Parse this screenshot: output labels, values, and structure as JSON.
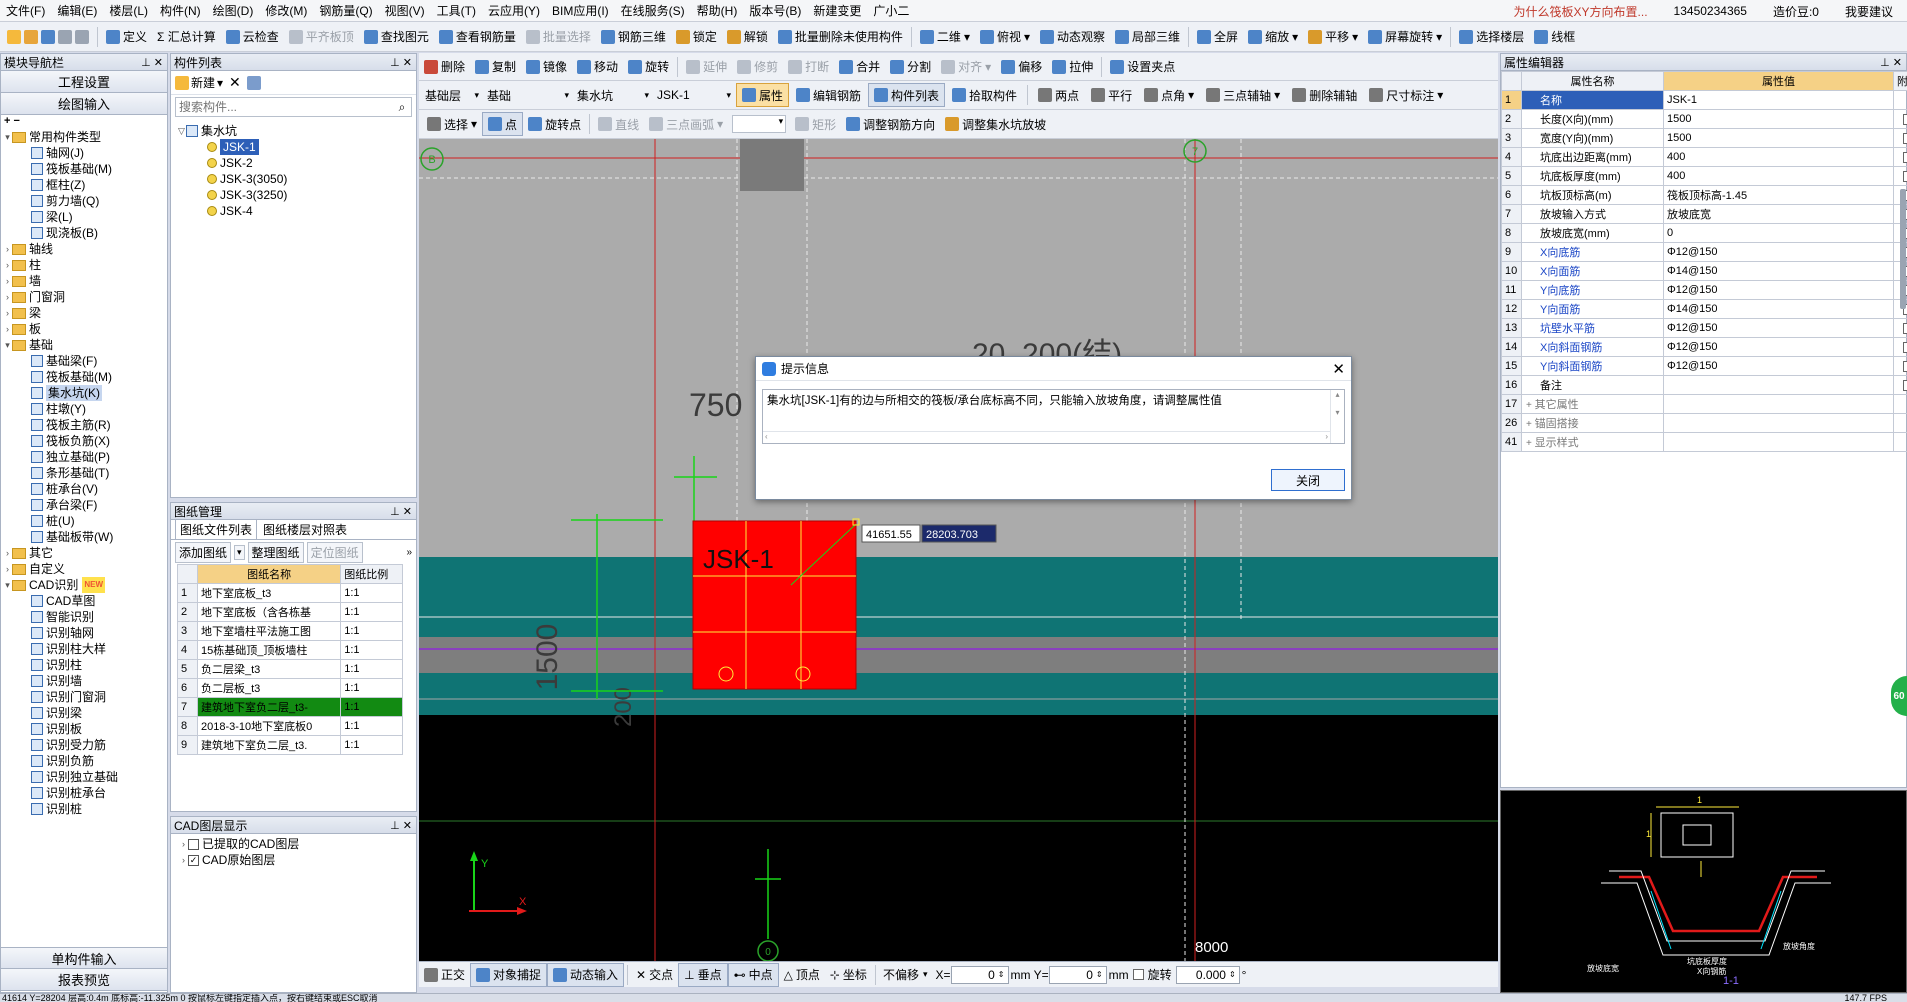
{
  "menubar": {
    "items": [
      "文件(F)",
      "编辑(E)",
      "楼层(L)",
      "构件(N)",
      "绘图(D)",
      "修改(M)",
      "钢筋量(Q)",
      "视图(V)",
      "工具(T)",
      "云应用(Y)",
      "BIM应用(I)",
      "在线服务(S)",
      "帮助(H)",
      "版本号(B)",
      "新建变更",
      "广小二"
    ],
    "ad_text": "为什么筏板XY方向布置...",
    "phone": "13450234365",
    "coin": "造价豆:0",
    "suggest": "我要建议"
  },
  "toolbar1": {
    "items": [
      "定义",
      "Σ 汇总计算",
      "云检查",
      "平齐板顶",
      "查找图元",
      "查看钢筋量",
      "批量选择",
      "钢筋三维",
      "锁定",
      "解锁",
      "批量删除未使用构件",
      "二维",
      "俯视",
      "动态观察",
      "局部三维",
      "全屏",
      "缩放",
      "平移",
      "屏幕旋转",
      "选择楼层",
      "线框"
    ]
  },
  "toolbar2": {
    "items": [
      "删除",
      "复制",
      "镜像",
      "移动",
      "旋转",
      "延伸",
      "修剪",
      "打断",
      "合并",
      "分割",
      "对齐",
      "偏移",
      "拉伸",
      "设置夹点"
    ]
  },
  "toolbar3": {
    "floor": "基础层",
    "category": "基础",
    "type": "集水坑",
    "component": "JSK-1",
    "items": [
      "属性",
      "编辑钢筋",
      "构件列表",
      "拾取构件",
      "两点",
      "平行",
      "点角",
      "三点辅轴",
      "删除辅轴",
      "尺寸标注"
    ]
  },
  "toolbar4": {
    "items": [
      "选择",
      "点",
      "旋转点",
      "直线",
      "三点画弧",
      "矩形",
      "调整钢筋方向",
      "调整集水坑放坡"
    ]
  },
  "nav": {
    "title": "模块导航栏",
    "btn1": "工程设置",
    "btn2": "绘图输入",
    "tree": [
      {
        "label": "常用构件类型",
        "level": 0,
        "folder": true,
        "open": true
      },
      {
        "label": "轴网(J)",
        "level": 1
      },
      {
        "label": "筏板基础(M)",
        "level": 1
      },
      {
        "label": "框柱(Z)",
        "level": 1
      },
      {
        "label": "剪力墙(Q)",
        "level": 1
      },
      {
        "label": "梁(L)",
        "level": 1
      },
      {
        "label": "现浇板(B)",
        "level": 1
      },
      {
        "label": "轴线",
        "level": 0,
        "folder": true
      },
      {
        "label": "柱",
        "level": 0,
        "folder": true
      },
      {
        "label": "墙",
        "level": 0,
        "folder": true
      },
      {
        "label": "门窗洞",
        "level": 0,
        "folder": true
      },
      {
        "label": "梁",
        "level": 0,
        "folder": true
      },
      {
        "label": "板",
        "level": 0,
        "folder": true
      },
      {
        "label": "基础",
        "level": 0,
        "folder": true,
        "open": true
      },
      {
        "label": "基础梁(F)",
        "level": 1
      },
      {
        "label": "筏板基础(M)",
        "level": 1
      },
      {
        "label": "集水坑(K)",
        "level": 1,
        "selected": true
      },
      {
        "label": "柱墩(Y)",
        "level": 1
      },
      {
        "label": "筏板主筋(R)",
        "level": 1
      },
      {
        "label": "筏板负筋(X)",
        "level": 1
      },
      {
        "label": "独立基础(P)",
        "level": 1
      },
      {
        "label": "条形基础(T)",
        "level": 1
      },
      {
        "label": "桩承台(V)",
        "level": 1
      },
      {
        "label": "承台梁(F)",
        "level": 1
      },
      {
        "label": "桩(U)",
        "level": 1
      },
      {
        "label": "基础板带(W)",
        "level": 1
      },
      {
        "label": "其它",
        "level": 0,
        "folder": true
      },
      {
        "label": "自定义",
        "level": 0,
        "folder": true
      },
      {
        "label": "CAD识别",
        "level": 0,
        "folder": true,
        "open": true,
        "badge": "NEW"
      },
      {
        "label": "CAD草图",
        "level": 1
      },
      {
        "label": "智能识别",
        "level": 1
      },
      {
        "label": "识别轴网",
        "level": 1
      },
      {
        "label": "识别柱大样",
        "level": 1
      },
      {
        "label": "识别柱",
        "level": 1
      },
      {
        "label": "识别墙",
        "level": 1
      },
      {
        "label": "识别门窗洞",
        "level": 1
      },
      {
        "label": "识别梁",
        "level": 1
      },
      {
        "label": "识别板",
        "level": 1
      },
      {
        "label": "识别受力筋",
        "level": 1
      },
      {
        "label": "识别负筋",
        "level": 1
      },
      {
        "label": "识别独立基础",
        "level": 1
      },
      {
        "label": "识别桩承台",
        "level": 1
      },
      {
        "label": "识别桩",
        "level": 1
      }
    ],
    "bottom1": "单构件输入",
    "bottom2": "报表预览"
  },
  "complist": {
    "title": "构件列表",
    "new_label": "新建",
    "search_placeholder": "搜索构件...",
    "root": "集水坑",
    "items": [
      "JSK-1",
      "JSK-2",
      "JSK-3(3050)",
      "JSK-3(3250)",
      "JSK-4"
    ]
  },
  "drawings": {
    "title": "图纸管理",
    "tab1": "图纸文件列表",
    "tab2": "图纸楼层对照表",
    "btn_add": "添加图纸",
    "btn_org": "整理图纸",
    "btn_loc": "定位图纸",
    "col_name": "图纸名称",
    "col_scale": "图纸比例",
    "rows": [
      {
        "n": "1",
        "name": "地下室底板_t3",
        "scale": "1:1"
      },
      {
        "n": "2",
        "name": "地下室底板（含各栋基",
        "scale": "1:1"
      },
      {
        "n": "3",
        "name": "地下室墙柱平法施工图",
        "scale": "1:1"
      },
      {
        "n": "4",
        "name": "15栋基础顶_顶板墙柱",
        "scale": "1:1"
      },
      {
        "n": "5",
        "name": "负二层梁_t3",
        "scale": "1:1"
      },
      {
        "n": "6",
        "name": "负二层板_t3",
        "scale": "1:1"
      },
      {
        "n": "7",
        "name": "建筑地下室负二层_t3-",
        "scale": "1:1"
      },
      {
        "n": "8",
        "name": "2018-3-10地下室底板0",
        "scale": "1:1"
      },
      {
        "n": "9",
        "name": "建筑地下室负二层_t3.",
        "scale": "1:1"
      }
    ]
  },
  "cadlayers": {
    "title": "CAD图层显示",
    "items": [
      {
        "label": "已提取的CAD图层",
        "checked": false
      },
      {
        "label": "CAD原始图层",
        "checked": true
      }
    ]
  },
  "canvas": {
    "axis_b": "B",
    "axis_7": "7",
    "axis_0": "0",
    "dim_750": "750",
    "dim_1500": "1500",
    "dim_200": "200",
    "dim_8000": "8000",
    "label_20200": "20_200(结)",
    "pit_label": "JSK-1",
    "coord_x": "41651.55",
    "coord_y": "28203.703"
  },
  "dialog": {
    "title": "提示信息",
    "message": "集水坑[JSK-1]有的边与所相交的筏板/承台底标高不同，只能输入放坡角度，请调整属性值",
    "close_btn": "关闭"
  },
  "props": {
    "title": "属性编辑器",
    "col_name": "属性名称",
    "col_value": "属性值",
    "col_extra": "附加",
    "rows": [
      {
        "n": "1",
        "name": "名称",
        "value": "JSK-1",
        "blue": false,
        "check": false,
        "selected": true
      },
      {
        "n": "2",
        "name": "长度(X向)(mm)",
        "value": "1500",
        "blue": false,
        "check": true
      },
      {
        "n": "3",
        "name": "宽度(Y向)(mm)",
        "value": "1500",
        "blue": false,
        "check": true
      },
      {
        "n": "4",
        "name": "坑底出边距离(mm)",
        "value": "400",
        "blue": false,
        "check": true
      },
      {
        "n": "5",
        "name": "坑底板厚度(mm)",
        "value": "400",
        "blue": false,
        "check": true
      },
      {
        "n": "6",
        "name": "坑板顶标高(m)",
        "value": "筏板顶标高-1.45",
        "blue": false,
        "check": true
      },
      {
        "n": "7",
        "name": "放坡输入方式",
        "value": "放坡底宽",
        "blue": false,
        "check": true
      },
      {
        "n": "8",
        "name": "放坡底宽(mm)",
        "value": "0",
        "blue": false,
        "check": true
      },
      {
        "n": "9",
        "name": "X向底筋",
        "value": "Φ12@150",
        "blue": true,
        "check": true
      },
      {
        "n": "10",
        "name": "X向面筋",
        "value": "Φ14@150",
        "blue": true,
        "check": true
      },
      {
        "n": "11",
        "name": "Y向底筋",
        "value": "Φ12@150",
        "blue": true,
        "check": true
      },
      {
        "n": "12",
        "name": "Y向面筋",
        "value": "Φ14@150",
        "blue": true,
        "check": true
      },
      {
        "n": "13",
        "name": "坑壁水平筋",
        "value": "Φ12@150",
        "blue": true,
        "check": true
      },
      {
        "n": "14",
        "name": "X向斜面钢筋",
        "value": "Φ12@150",
        "blue": true,
        "check": true
      },
      {
        "n": "15",
        "name": "Y向斜面钢筋",
        "value": "Φ12@150",
        "blue": true,
        "check": true
      },
      {
        "n": "16",
        "name": "备注",
        "value": "",
        "blue": false,
        "check": true
      },
      {
        "n": "17",
        "name": "其它属性",
        "value": "",
        "blue": false,
        "check": false,
        "group": true
      },
      {
        "n": "26",
        "name": "锚固搭接",
        "value": "",
        "blue": false,
        "check": false,
        "group": true
      },
      {
        "n": "41",
        "name": "显示样式",
        "value": "",
        "blue": false,
        "check": false,
        "group": true
      }
    ]
  },
  "preview": {
    "dim_a": "1",
    "dim_b": "1",
    "label_section": "1-1",
    "label_corner": "放坡底宽",
    "label_slope": "放坡角度",
    "label_bottom": "坑底板厚度",
    "label_bars": "X向钢筋"
  },
  "bottombar": {
    "items": [
      "正交",
      "对象捕捉",
      "动态输入",
      "交点",
      "垂点",
      "中点",
      "顶点",
      "坐标"
    ],
    "offset_mode": "不偏移",
    "x_label": "X=",
    "x_val": "0",
    "y_label": "mm Y=",
    "y_val": "0",
    "mm": "mm",
    "rotate_label": "旋转",
    "rotate_val": "0.000",
    "deg": "°"
  },
  "status": {
    "text": "41614 Y=28204      层高:0.4m      底标高:-11.325m      0      按鼠标左键指定插入点，按右键结束或ESC取消",
    "fps": "147.7 FPS"
  },
  "green_badge": "60"
}
